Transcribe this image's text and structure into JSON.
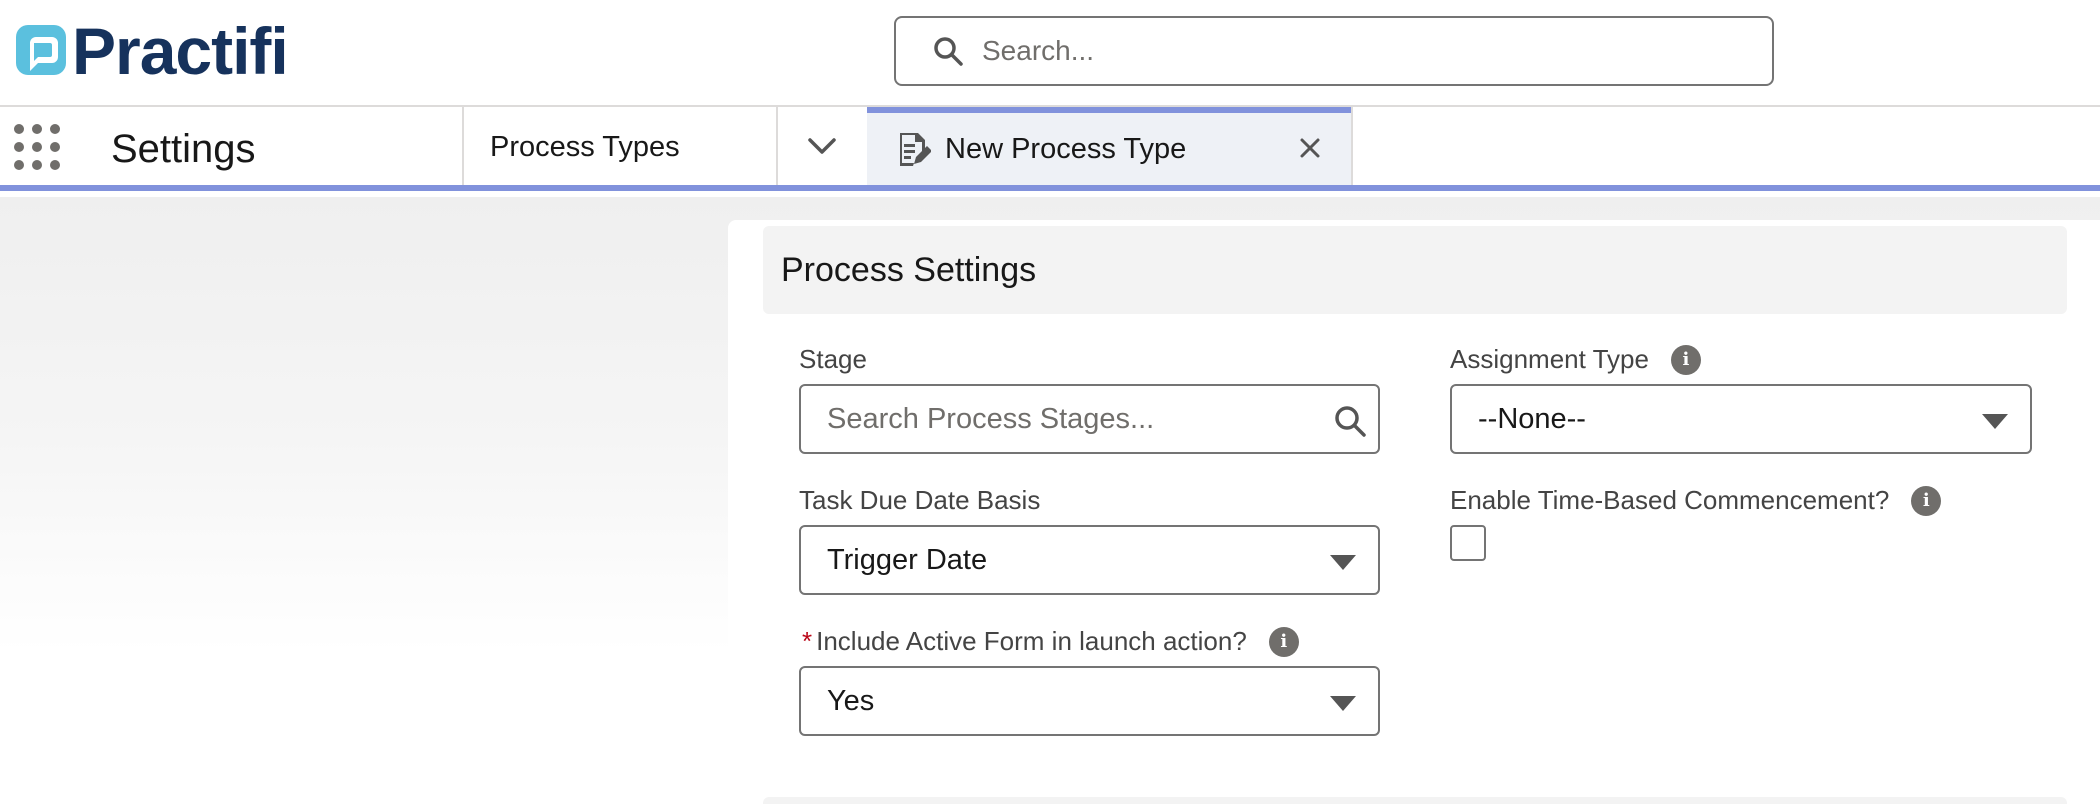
{
  "header": {
    "logo_text": "Practifi",
    "search_placeholder": "Search..."
  },
  "nav": {
    "app_name": "Settings",
    "item_label": "Process Types",
    "active_tab_label": "New Process Type"
  },
  "section": {
    "title": "Process Settings"
  },
  "form": {
    "stage": {
      "label": "Stage",
      "placeholder": "Search Process Stages..."
    },
    "assignment_type": {
      "label": "Assignment Type",
      "value": "--None--"
    },
    "task_due_date_basis": {
      "label": "Task Due Date Basis",
      "value": "Trigger Date"
    },
    "time_based": {
      "label": "Enable Time-Based Commencement?",
      "checked": false
    },
    "include_active_form": {
      "required_mark": "*",
      "label": "Include Active Form in launch action?",
      "value": "Yes"
    }
  },
  "icons": {
    "info_glyph": "i"
  },
  "colors": {
    "brand_navy": "#16325c",
    "brand_teal": "#5bc0de",
    "accent_tab": "#8192dc",
    "required": "#ba0517"
  }
}
